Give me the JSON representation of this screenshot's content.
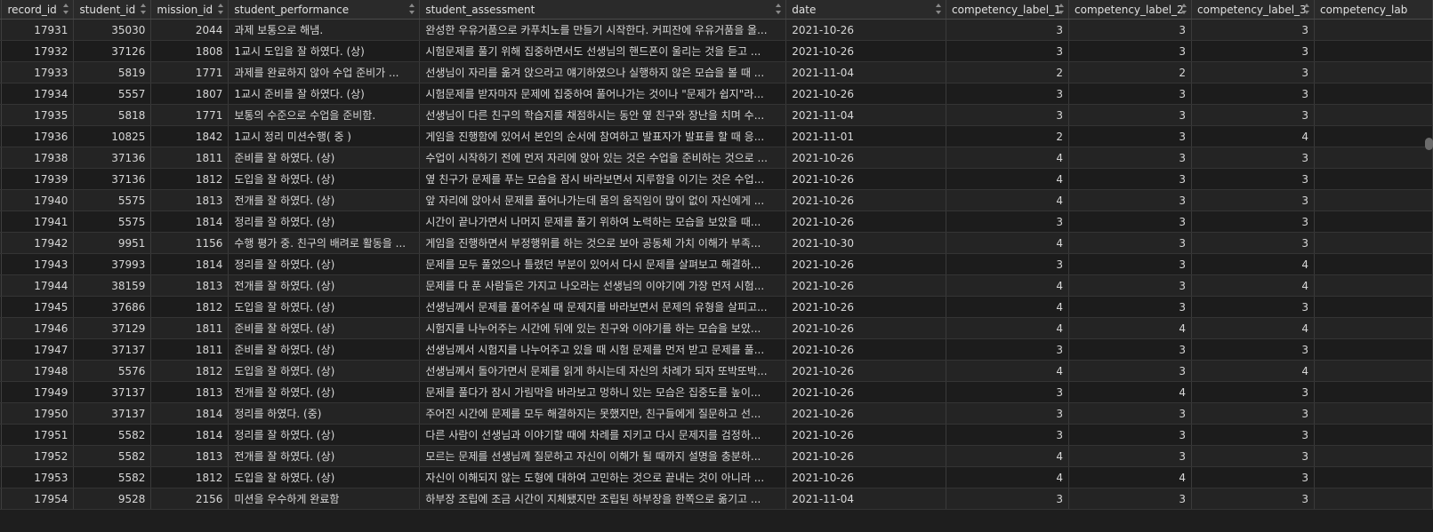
{
  "columns": [
    {
      "key": "record_id",
      "label": "record_id"
    },
    {
      "key": "student_id",
      "label": "student_id"
    },
    {
      "key": "mission_id",
      "label": "mission_id"
    },
    {
      "key": "student_performance",
      "label": "student_performance"
    },
    {
      "key": "student_assessment",
      "label": "student_assessment"
    },
    {
      "key": "date",
      "label": "date"
    },
    {
      "key": "competency_label_1",
      "label": "competency_label_1"
    },
    {
      "key": "competency_label_2",
      "label": "competency_label_2"
    },
    {
      "key": "competency_label_3",
      "label": "competency_label_3"
    },
    {
      "key": "competency_label_4",
      "label": "competency_lab"
    }
  ],
  "rows": [
    [
      "17931",
      "35030",
      "2044",
      "과제 보통으로 해냄.",
      "완성한 우유거품으로 카푸치노를 만들기 시작한다. 커피잔에 우유거품을 올...",
      "2021-10-26",
      "3",
      "3",
      "3",
      ""
    ],
    [
      "17932",
      "37126",
      "1808",
      "1교시 도입을 잘 하였다. (상)",
      "시험문제를 풀기 위해 집중하면서도 선생님의 핸드폰이 울리는 것을 듣고 ...",
      "2021-10-26",
      "3",
      "3",
      "3",
      ""
    ],
    [
      "17933",
      "5819",
      "1771",
      "과제를 완료하지 않아 수업 준비가 ...",
      "선생님이 자리를 옮겨 앉으라고 얘기하였으나 실행하지 않은 모습을 볼 때 ...",
      "2021-11-04",
      "2",
      "2",
      "3",
      ""
    ],
    [
      "17934",
      "5557",
      "1807",
      "1교시 준비를 잘 하였다. (상)",
      "시험문제를 받자마자 문제에 집중하여 풀어나가는 것이나 \"문제가 쉽지\"라...",
      "2021-10-26",
      "3",
      "3",
      "3",
      ""
    ],
    [
      "17935",
      "5818",
      "1771",
      "보통의 수준으로 수업을 준비함.",
      "선생님이 다른 친구의 학습지를 채점하시는 동안 옆 친구와 장난을 치며 수...",
      "2021-11-04",
      "3",
      "3",
      "3",
      ""
    ],
    [
      "17936",
      "10825",
      "1842",
      "1교시 정리 미션수행( 중 )",
      "게임을 진행함에 있어서 본인의 순서에 참여하고 발표자가 발표를 할 때 응...",
      "2021-11-01",
      "2",
      "3",
      "4",
      ""
    ],
    [
      "17938",
      "37136",
      "1811",
      "준비를 잘 하였다. (상)",
      "수업이 시작하기 전에 먼저 자리에 앉아 있는 것은 수업을 준비하는 것으로 ...",
      "2021-10-26",
      "4",
      "3",
      "3",
      ""
    ],
    [
      "17939",
      "37136",
      "1812",
      "도입을 잘 하였다. (상)",
      "옆 친구가 문제를 푸는 모습을 잠시 바라보면서 지루함을 이기는 것은 수업...",
      "2021-10-26",
      "4",
      "3",
      "3",
      ""
    ],
    [
      "17940",
      "5575",
      "1813",
      "전개를 잘 하였다. (상)",
      "앞 자리에 앉아서 문제를 풀어나가는데 몸의 움직임이 많이 없이 자신에게 ...",
      "2021-10-26",
      "4",
      "3",
      "3",
      ""
    ],
    [
      "17941",
      "5575",
      "1814",
      "정리를 잘 하였다. (상)",
      "시간이 끝나가면서 나머지 문제를 풀기 위하여 노력하는 모습을 보았을 때...",
      "2021-10-26",
      "3",
      "3",
      "3",
      ""
    ],
    [
      "17942",
      "9951",
      "1156",
      "수행 평가 중. 친구의 배려로 활동을 ...",
      "게임을 진행하면서 부정행위를 하는 것으로 보아 공동체 가치 이해가 부족...",
      "2021-10-30",
      "4",
      "3",
      "3",
      ""
    ],
    [
      "17943",
      "37993",
      "1814",
      "정리를 잘 하였다. (상)",
      "문제를 모두 풀었으나 틀렸던 부분이 있어서 다시 문제를 살펴보고 해결하...",
      "2021-10-26",
      "3",
      "3",
      "4",
      ""
    ],
    [
      "17944",
      "38159",
      "1813",
      "전개를 잘 하였다. (상)",
      "문제를 다 푼 사람들은 가지고 나오라는 선생님의 이야기에 가장 먼저 시험...",
      "2021-10-26",
      "4",
      "3",
      "4",
      ""
    ],
    [
      "17945",
      "37686",
      "1812",
      "도입을 잘 하였다. (상)",
      "선생님께서 문제를 풀어주실 때 문제지를 바라보면서 문제의 유형을 살피고...",
      "2021-10-26",
      "4",
      "3",
      "3",
      ""
    ],
    [
      "17946",
      "37129",
      "1811",
      "준비를 잘 하였다. (상)",
      "시험지를 나누어주는 시간에 뒤에 있는 친구와 이야기를 하는 모습을 보았...",
      "2021-10-26",
      "4",
      "4",
      "4",
      ""
    ],
    [
      "17947",
      "37137",
      "1811",
      "준비를 잘 하였다. (상)",
      "선생님께서 시험지를 나누어주고 있을 때 시험 문제를 먼저 받고 문제를 풀...",
      "2021-10-26",
      "3",
      "3",
      "3",
      ""
    ],
    [
      "17948",
      "5576",
      "1812",
      "도입을 잘 하였다. (상)",
      "선생님께서 돌아가면서 문제를 읽게 하시는데 자신의 차례가 되자 또박또박...",
      "2021-10-26",
      "4",
      "3",
      "4",
      ""
    ],
    [
      "17949",
      "37137",
      "1813",
      "전개를 잘 하였다. (상)",
      "문제를 풀다가 잠시 가림막을 바라보고 멍하니 있는 모습은 집중도를 높이...",
      "2021-10-26",
      "3",
      "4",
      "3",
      ""
    ],
    [
      "17950",
      "37137",
      "1814",
      "정리를 하였다. (중)",
      "주어진 시간에 문제를 모두 해결하지는 못했지만, 친구들에게 질문하고 선...",
      "2021-10-26",
      "3",
      "3",
      "3",
      ""
    ],
    [
      "17951",
      "5582",
      "1814",
      "정리를 잘 하였다. (상)",
      "다른 사람이 선생님과 이야기할 때에 차례를 지키고 다시 문제지를 검정하...",
      "2021-10-26",
      "3",
      "3",
      "3",
      ""
    ],
    [
      "17952",
      "5582",
      "1813",
      "전개를 잘 하였다. (상)",
      "모르는 문제를 선생님께 질문하고 자신이 이해가 될 때까지 설명을 충분하...",
      "2021-10-26",
      "4",
      "3",
      "3",
      ""
    ],
    [
      "17953",
      "5582",
      "1812",
      "도입을 잘 하였다. (상)",
      "자신이 이해되지 않는 도형에 대하여 고민하는 것으로 끝내는 것이 아니라 ...",
      "2021-10-26",
      "4",
      "4",
      "3",
      ""
    ],
    [
      "17954",
      "9528",
      "2156",
      "미션을 우수하게 완료함",
      "하부장 조립에 조금 시간이 지체됐지만 조립된 하부장을 한쪽으로 옮기고 ...",
      "2021-11-04",
      "3",
      "3",
      "3",
      ""
    ]
  ],
  "icons": {
    "sort": "sort-arrows-icon"
  },
  "colors": {
    "background": "#1e1e1e",
    "header": "#2a2a2a",
    "text": "#d8d8d8"
  }
}
